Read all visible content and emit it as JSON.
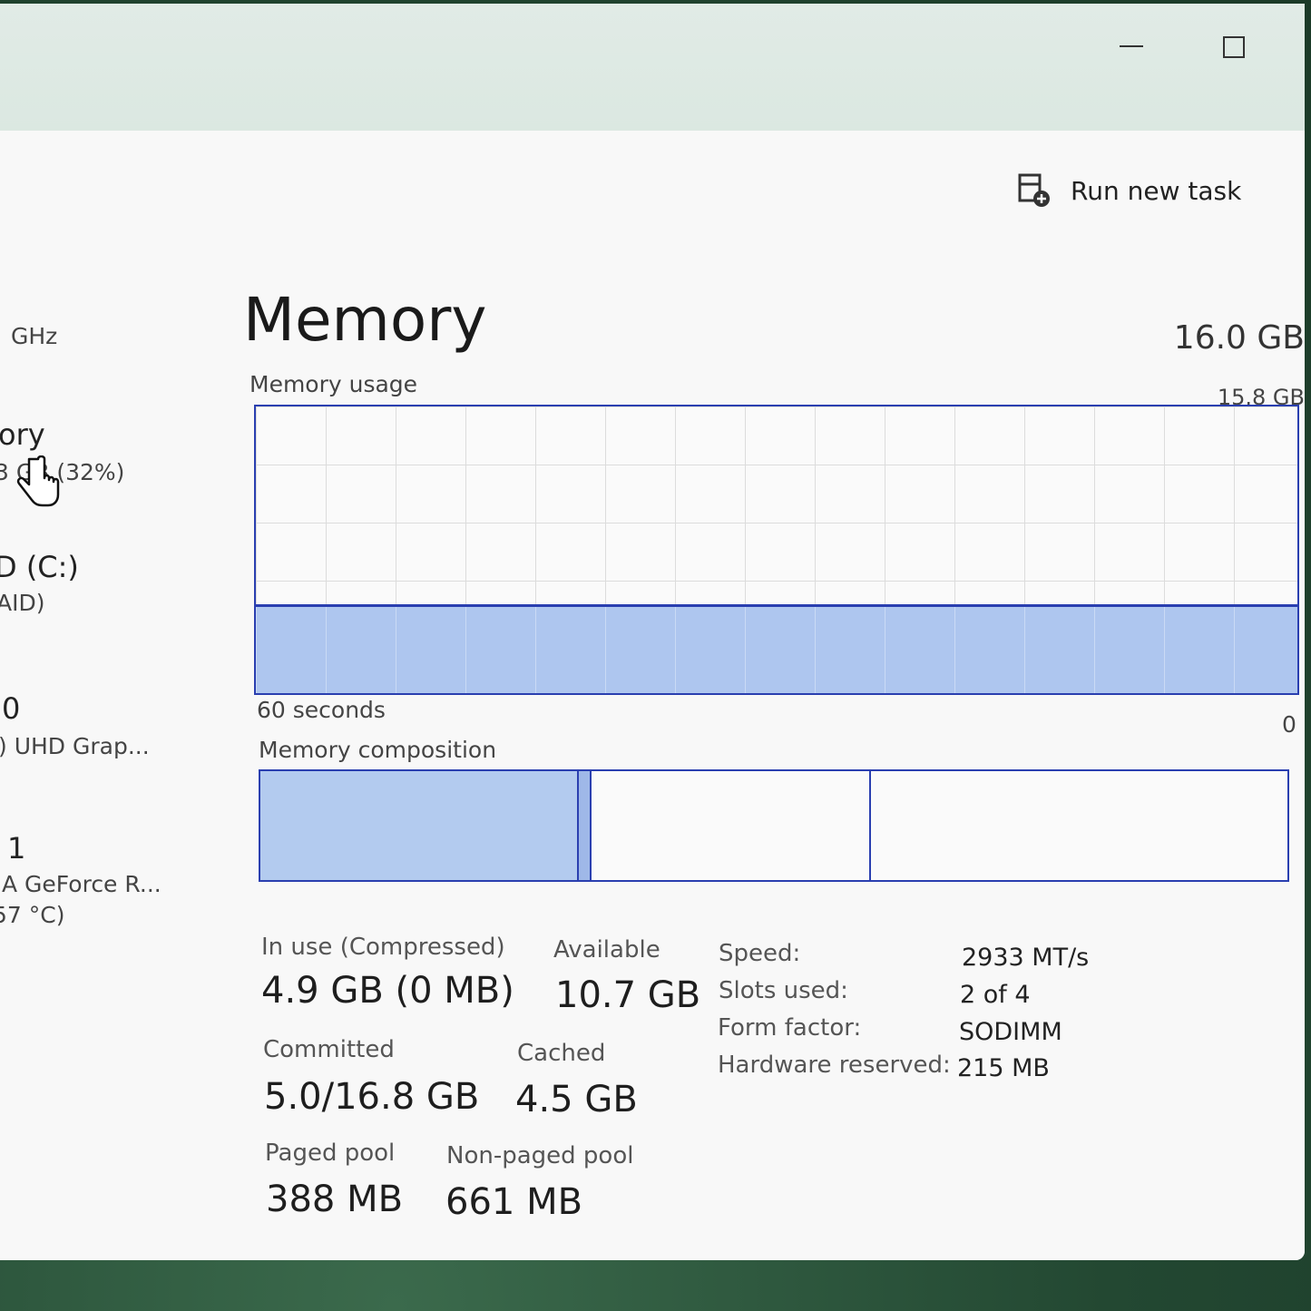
{
  "toolbar": {
    "run_new_task_label": "Run new task"
  },
  "sidebar": {
    "cpu_speed": "GHz",
    "memory_title": "ory",
    "memory_detail": "3 GB (32%)",
    "disk_title": "D (C:)",
    "disk_detail": "AID)",
    "gpu0_title": "0",
    "gpu0_detail": ") UHD Grap...",
    "gpu1_title": "1",
    "gpu1_detail": "A GeForce R...",
    "gpu1_temp": "57 °C)"
  },
  "memory": {
    "title": "Memory",
    "total": "16.0 GB",
    "usage_label": "Memory usage",
    "usage_max": "15.8 GB",
    "graph_time": "60 seconds",
    "graph_min": "0",
    "usage_fraction": 0.31,
    "composition_label": "Memory composition",
    "composition": {
      "in_use_gb": 4.9,
      "modified_gb": 0.2,
      "standby_gb": 4.3,
      "free_gb": 6.4
    },
    "stats": {
      "in_use_label": "In use (Compressed)",
      "in_use_value": "4.9 GB (0 MB)",
      "available_label": "Available",
      "available_value": "10.7 GB",
      "committed_label": "Committed",
      "committed_value": "5.0/16.8 GB",
      "cached_label": "Cached",
      "cached_value": "4.5 GB",
      "paged_pool_label": "Paged pool",
      "paged_pool_value": "388 MB",
      "nonpaged_pool_label": "Non-paged pool",
      "nonpaged_pool_value": "661 MB"
    },
    "specs": {
      "speed_key": "Speed:",
      "speed_value": "2933 MT/s",
      "slots_key": "Slots used:",
      "slots_value": "2 of 4",
      "form_key": "Form factor:",
      "form_value": "SODIMM",
      "hw_key": "Hardware reserved:",
      "hw_value": "215 MB"
    }
  },
  "colors": {
    "accent": "#2a3fb0",
    "fill": "#aec6ef"
  },
  "icons": {
    "run_task": "run-new-task-icon",
    "minimize": "minimize-icon",
    "maximize": "maximize-icon",
    "cursor": "hand-cursor-icon"
  }
}
